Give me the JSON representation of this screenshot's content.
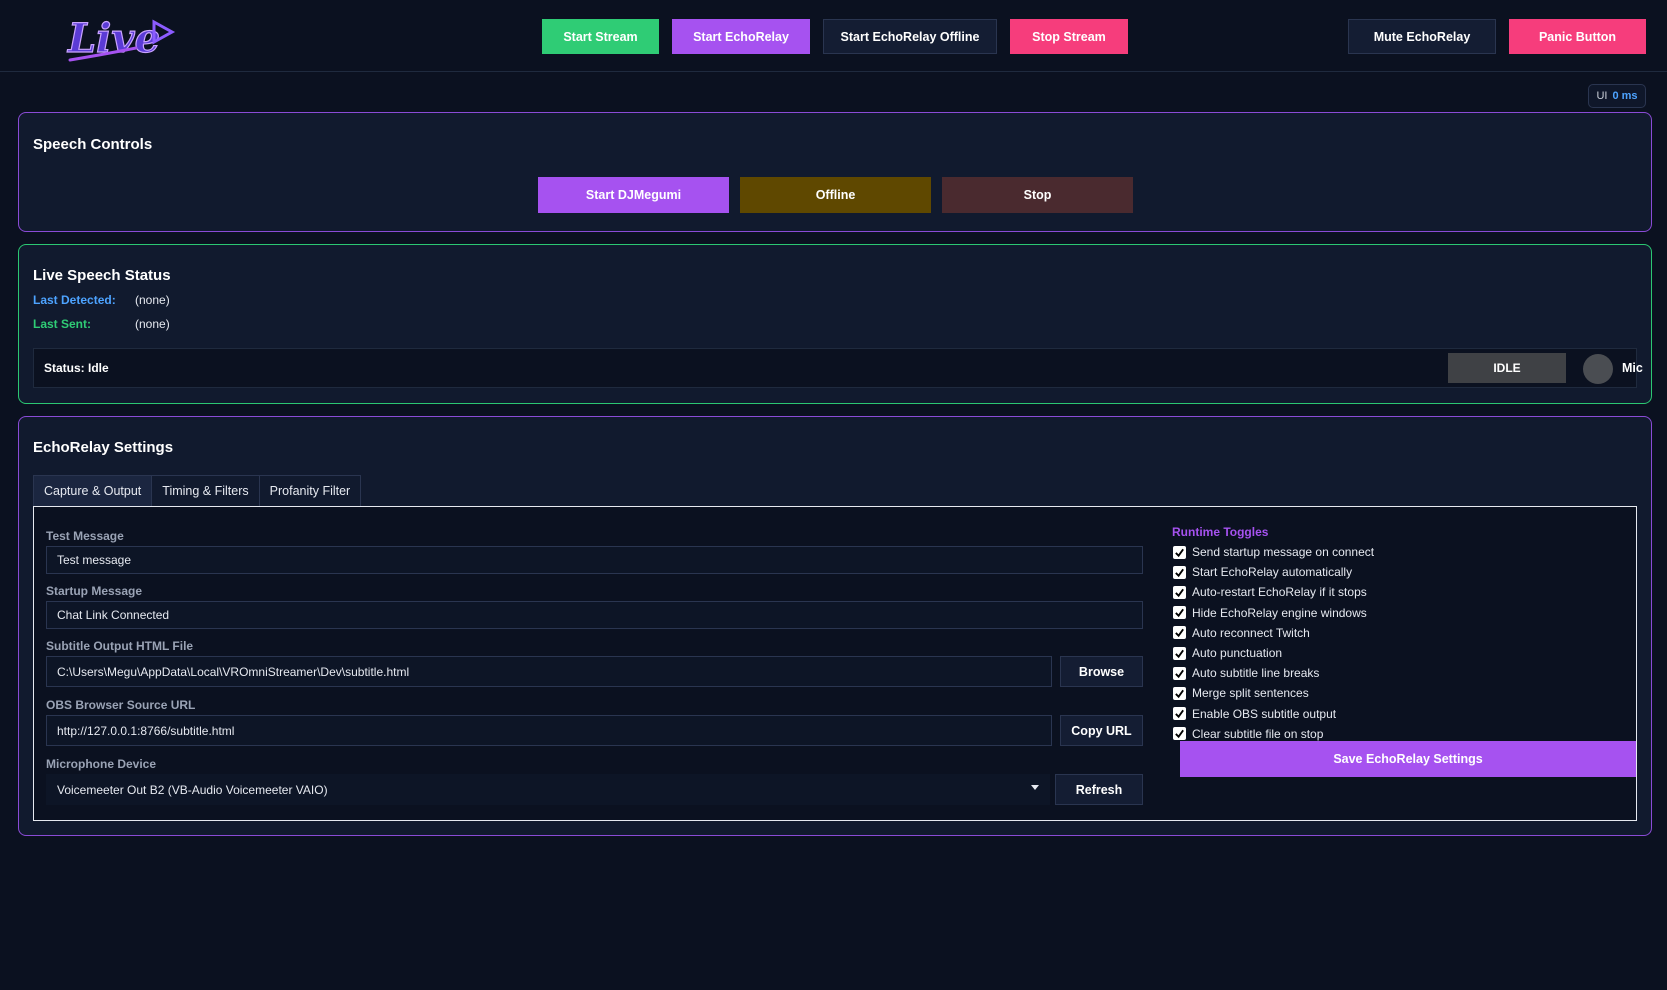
{
  "header": {
    "logo_text": "Live",
    "buttons": {
      "start_stream": "Start Stream",
      "start_echorelay": "Start EchoRelay",
      "start_echorelay_offline": "Start EchoRelay Offline",
      "stop_stream": "Stop Stream",
      "mute_echorelay": "Mute EchoRelay",
      "panic_button": "Panic Button"
    }
  },
  "ui_badge": {
    "label": "UI",
    "value": "0 ms"
  },
  "speech_controls": {
    "title": "Speech Controls",
    "start_label": "Start DJMegumi",
    "offline_label": "Offline",
    "stop_label": "Stop"
  },
  "live_status": {
    "title": "Live Speech Status",
    "last_detected_label": "Last Detected:",
    "last_detected_value": "(none)",
    "last_sent_label": "Last Sent:",
    "last_sent_value": "(none)",
    "status_text": "Status: Idle",
    "state_badge": "IDLE",
    "mic_label": "Mic"
  },
  "settings": {
    "title": "EchoRelay Settings",
    "tabs": [
      "Capture & Output",
      "Timing & Filters",
      "Profanity Filter"
    ],
    "fields": {
      "test_message_label": "Test Message",
      "test_message_value": "Test message",
      "startup_message_label": "Startup Message",
      "startup_message_value": "Chat Link Connected",
      "subtitle_file_label": "Subtitle Output HTML File",
      "subtitle_file_value": "C:\\Users\\Megu\\AppData\\Local\\VROmniStreamer\\Dev\\subtitle.html",
      "browse_label": "Browse",
      "obs_url_label": "OBS Browser Source URL",
      "obs_url_value": "http://127.0.0.1:8766/subtitle.html",
      "copy_url_label": "Copy URL",
      "mic_device_label": "Microphone Device",
      "mic_device_value": "Voicemeeter Out B2 (VB-Audio Voicemeeter VAIO)",
      "refresh_label": "Refresh"
    },
    "runtime_title": "Runtime Toggles",
    "toggles": [
      "Send startup message on connect",
      "Start EchoRelay automatically",
      "Auto-restart EchoRelay if it stops",
      "Hide EchoRelay engine windows",
      "Auto reconnect Twitch",
      "Auto punctuation",
      "Auto subtitle line breaks",
      "Merge split sentences",
      "Enable OBS subtitle output",
      "Clear subtitle file on stop"
    ],
    "save_label": "Save EchoRelay Settings"
  },
  "colors": {
    "accent_purple": "#a652f0",
    "accent_green": "#2fcc75",
    "accent_pink": "#f63d7c",
    "background": "#0b1120"
  }
}
